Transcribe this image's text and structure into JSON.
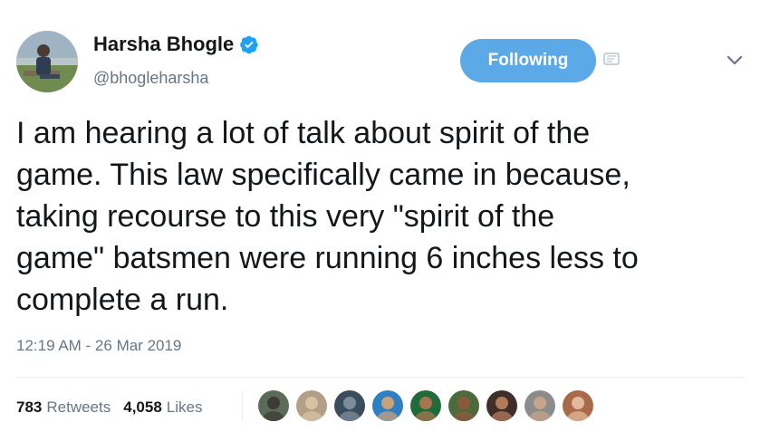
{
  "user": {
    "display_name": "Harsha Bhogle",
    "handle": "@bhogleharsha",
    "verified": true,
    "avatar_icon": "profile-photo"
  },
  "actions": {
    "follow_label": "Following",
    "dm_icon": "message-icon",
    "menu_icon": "chevron-down-icon"
  },
  "tweet": {
    "text": "I am hearing a lot of talk about spirit of the\ngame. This law specifically came in because,\ntaking recourse to this very \"spirit of the\ngame\" batsmen were running 6 inches less to\ncomplete a run.",
    "timestamp": "12:19 AM - 26 Mar 2019"
  },
  "stats": {
    "retweets_count": "783",
    "retweets_label": "Retweets",
    "likes_count": "4,058",
    "likes_label": "Likes"
  },
  "likers": [
    {
      "bg": "#5b6b5a",
      "face": "#3d3a33"
    },
    {
      "bg": "#b39f86",
      "face": "#d8c2a4"
    },
    {
      "bg": "#3b4c5c",
      "face": "#7d8c9a"
    },
    {
      "bg": "#2f7fc3",
      "face": "#c9a27c"
    },
    {
      "bg": "#1f6b3a",
      "face": "#a8744f"
    },
    {
      "bg": "#4d6a3c",
      "face": "#8c5a3b"
    },
    {
      "bg": "#3e2f2a",
      "face": "#b47b58"
    },
    {
      "bg": "#8c8c8c",
      "face": "#c7a489"
    },
    {
      "bg": "#a96a4a",
      "face": "#e2b99a"
    }
  ],
  "colors": {
    "accent": "#5ca9e8",
    "verified": "#1da1f2",
    "muted": "#657786"
  }
}
